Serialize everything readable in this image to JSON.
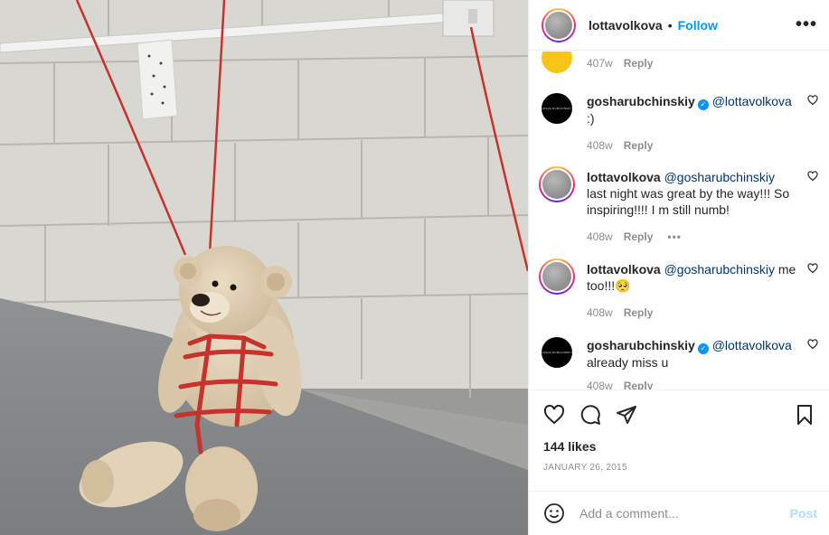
{
  "header": {
    "username": "lottavolkova",
    "separator": "•",
    "follow_label": "Follow",
    "more_label": "•••"
  },
  "comments": [
    {
      "username": "",
      "verified": false,
      "mention": "",
      "text": "",
      "time": "407w",
      "reply_label": "Reply",
      "avatar": "yellow-avatar-partial"
    },
    {
      "username": "gosharubchinskiy",
      "verified": true,
      "mention": "@lottavolkova",
      "text": ":)",
      "time": "408w",
      "reply_label": "Reply",
      "avatar": "black-logo-avatar"
    },
    {
      "username": "lottavolkova",
      "verified": false,
      "mention": "@gosharubchinskiy",
      "text": "last night was great by the way!!! So inspiring!!!! I m still numb!",
      "time": "408w",
      "reply_label": "Reply",
      "more_label": "•••",
      "avatar": "story-ring-avatar"
    },
    {
      "username": "lottavolkova",
      "verified": false,
      "mention": "@gosharubchinskiy",
      "text": "me too!!!🥺",
      "time": "408w",
      "reply_label": "Reply",
      "avatar": "story-ring-avatar"
    },
    {
      "username": "gosharubchinskiy",
      "verified": true,
      "mention": "@lottavolkova",
      "text": "already miss u",
      "time": "408w",
      "reply_label": "Reply",
      "avatar": "black-logo-avatar"
    }
  ],
  "actions": {
    "likes": "144 likes",
    "date": "JANUARY 26, 2015"
  },
  "add_comment": {
    "placeholder": "Add a comment...",
    "post_label": "Post"
  },
  "colors": {
    "accent": "#0095f6",
    "post_disabled": "#b2dffc",
    "meta_gray": "#8e8e8e",
    "cord_red": "#c8322d"
  },
  "icons": [
    "heart-icon",
    "comment-icon",
    "share-icon",
    "bookmark-icon",
    "smiley-icon",
    "more-icon",
    "verified-icon"
  ]
}
